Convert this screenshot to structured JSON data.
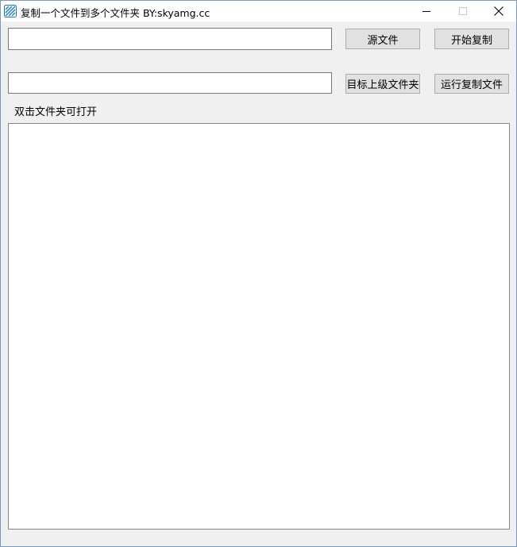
{
  "window": {
    "title": "复制一个文件到多个文件夹   BY:skyamg.cc",
    "icon": "app-icon"
  },
  "controls": {
    "source_field": {
      "value": "",
      "placeholder": ""
    },
    "target_field": {
      "value": "",
      "placeholder": ""
    },
    "source_button": "源文件",
    "start_copy_button": "开始复制",
    "target_parent_button": "目标上级文件夹",
    "run_copy_file_button": "运行复制文件",
    "hint_label": "双击文件夹可打开"
  },
  "folder_list": {
    "items": []
  },
  "colors": {
    "window_bg": "#f0f0f0",
    "titlebar_bg": "#ffffff",
    "button_bg": "#e1e1e1",
    "button_border": "#adadad",
    "accent": "#1a7bbf"
  }
}
